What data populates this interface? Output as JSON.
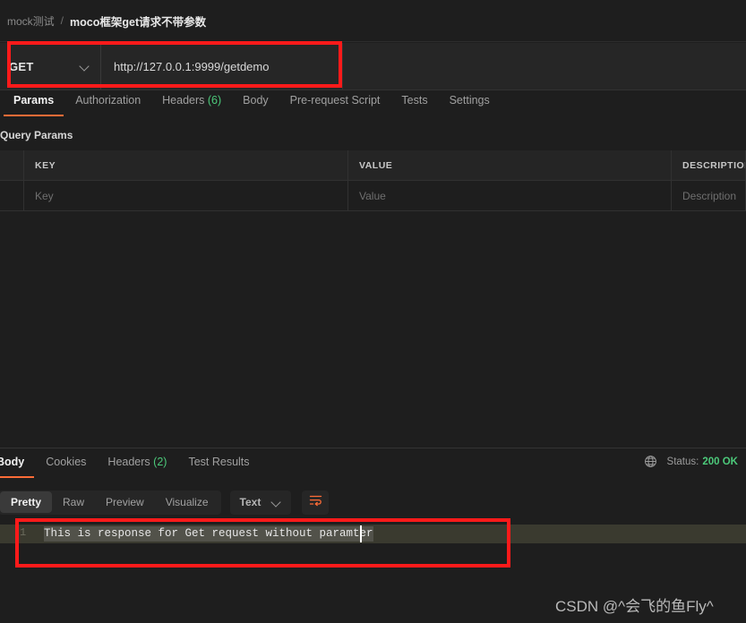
{
  "header": {
    "collection": "mock测试",
    "separator": "/",
    "request_name": "moco框架get请求不带参数"
  },
  "url_bar": {
    "method": "GET",
    "method_chevron_icon": "chevron-down-icon",
    "url": "http://127.0.0.1:9999/getdemo"
  },
  "request_tabs": [
    {
      "label": "Params",
      "active": true
    },
    {
      "label": "Authorization",
      "active": false
    },
    {
      "label": "Headers",
      "count": "(6)",
      "active": false
    },
    {
      "label": "Body",
      "active": false
    },
    {
      "label": "Pre-request Script",
      "active": false
    },
    {
      "label": "Tests",
      "active": false
    },
    {
      "label": "Settings",
      "active": false
    }
  ],
  "params": {
    "section_label": "Query Params",
    "columns": [
      "KEY",
      "VALUE",
      "DESCRIPTION"
    ],
    "empty_row_placeholders": {
      "key": "Key",
      "value": "Value",
      "description": "Description"
    }
  },
  "response_tabs": [
    {
      "label": "Body",
      "active": true
    },
    {
      "label": "Cookies",
      "active": false
    },
    {
      "label": "Headers",
      "count": "(2)",
      "active": false
    },
    {
      "label": "Test Results",
      "active": false
    }
  ],
  "response_status": {
    "globe_icon": "globe-icon",
    "label": "Status:",
    "value": "200 OK",
    "status_color": "#4cc97a"
  },
  "format_bar": {
    "views": [
      {
        "label": "Pretty",
        "active": true
      },
      {
        "label": "Raw",
        "active": false
      },
      {
        "label": "Preview",
        "active": false
      },
      {
        "label": "Visualize",
        "active": false
      }
    ],
    "language_select": {
      "value": "Text",
      "chevron_icon": "chevron-down-icon"
    },
    "wrap_icon": "wrap-text-icon"
  },
  "response_body": {
    "line_number": "1",
    "text": "This is response for Get request without paramter"
  },
  "annotations": {
    "color": "#ff1a1a"
  },
  "watermark": {
    "text": "CSDN @^会飞的鱼Fly^"
  },
  "theme": {
    "background": "#1e1e1e",
    "panel": "#262626",
    "accent": "#ff6c37",
    "success": "#4cc97a"
  }
}
